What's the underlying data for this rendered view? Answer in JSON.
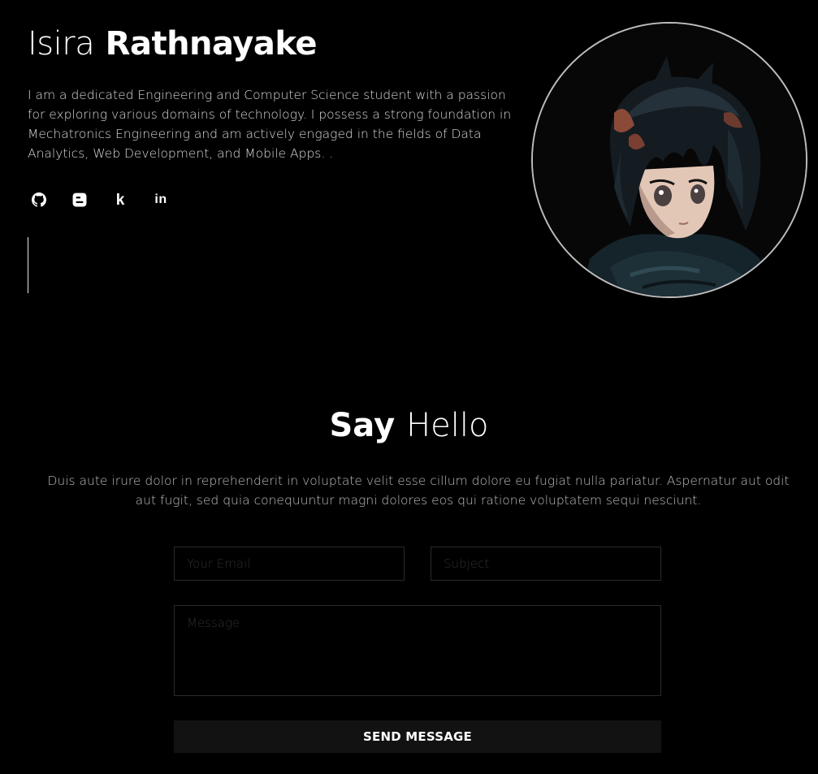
{
  "hero": {
    "first_name": "Isira",
    "last_name": "Rathnayake",
    "bio": "I am a dedicated Engineering and Computer Science student with a passion for exploring various domains of technology. I possess a strong foundation in Mechatronics Engineering and am actively engaged in the fields of Data Analytics, Web Development, and Mobile Apps. .",
    "socials": [
      {
        "icon": "github-icon"
      },
      {
        "icon": "blogger-icon"
      },
      {
        "icon": "kaggle-icon",
        "glyph": "k"
      },
      {
        "icon": "linkedin-icon",
        "glyph": "in"
      }
    ],
    "avatar_icon": "anime-portrait"
  },
  "contact": {
    "title_bold": "Say",
    "title_light": "Hello",
    "description": "Duis aute irure dolor in reprehenderit in voluptate velit esse cillum dolore eu fugiat nulla pariatur. Aspernatur aut odit aut fugit, sed quia conequuntur magni dolores eos qui ratione voluptatem sequi nesciunt.",
    "email_placeholder": "Your Email",
    "subject_placeholder": "Subject",
    "message_placeholder": "Message",
    "send_label": "SEND MESSAGE"
  },
  "colors": {
    "background": "#000000",
    "text": "#ffffff",
    "muted_text": "#bfbfbf",
    "field_border": "#2a2a2a",
    "button_bg": "#121212"
  }
}
